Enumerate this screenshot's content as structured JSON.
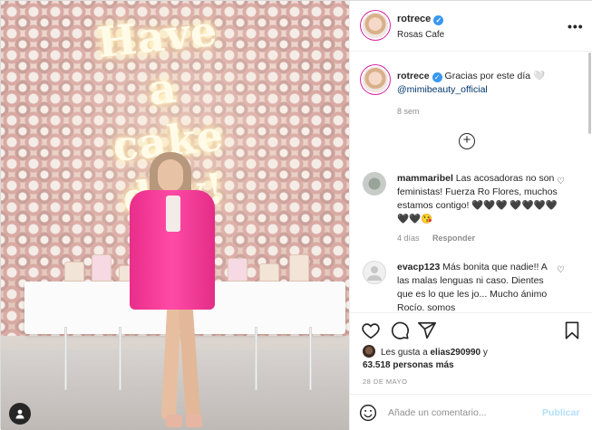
{
  "post": {
    "username": "rotrece",
    "location": "Rosas Cafe",
    "neon_text": "Have a cake day!",
    "more_icon": "more-horizontal-icon"
  },
  "caption": {
    "username": "rotrece",
    "text": "Gracias por este día 🤍",
    "mention": "@mimibeauty_official",
    "time": "8 sem"
  },
  "comments": [
    {
      "username": "mammaribel",
      "text": "Las acosadoras no son feministas! Fuerza Ro Flores, muchos estamos contigo! 🖤🖤🖤 🖤🖤🖤🖤🖤🖤😘",
      "time": "4 días",
      "reply": "Responder"
    },
    {
      "username": "evacp123",
      "text": "Más bonita que nadie!! A las malas lenguas ni caso. Dientes que es lo que les jo... Mucho ánimo Rocío. somos",
      "time": "",
      "reply": ""
    }
  ],
  "likes": {
    "prefix": "Les gusta a ",
    "user": "elias290990",
    "middle": " y",
    "count": "63.518 personas más"
  },
  "date": "28 DE MAYO",
  "add_comment": {
    "placeholder": "Añade un comentario...",
    "publish": "Publicar"
  },
  "colors": {
    "verified": "#3897f0",
    "publish_disabled": "#b2dffc",
    "jacket": "#ff4aa6"
  }
}
